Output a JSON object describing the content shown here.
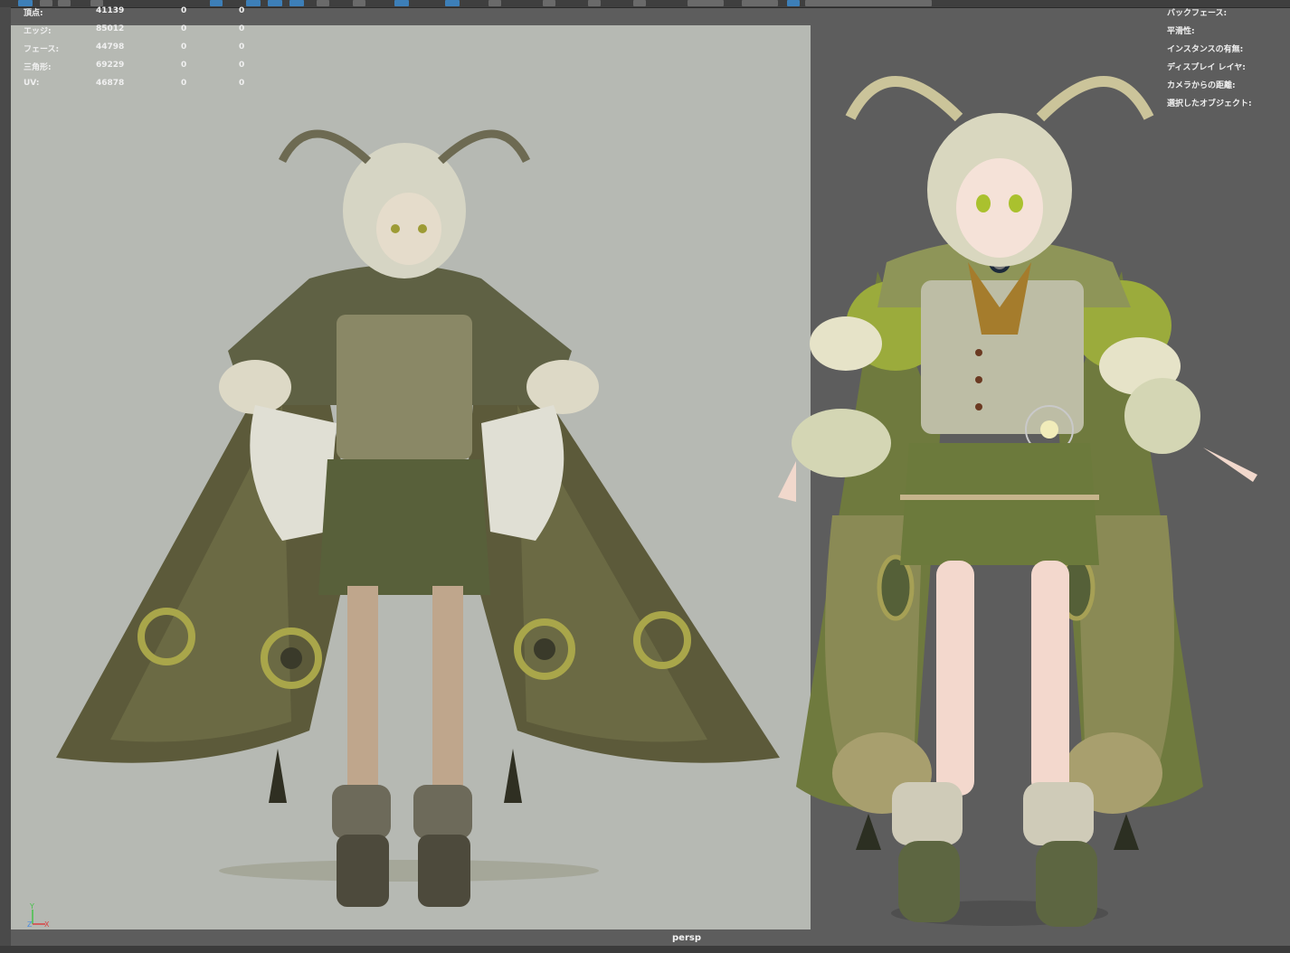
{
  "stats": {
    "rows": [
      {
        "label": "頂点:",
        "v1": "41139",
        "v2": "0",
        "v3": "0"
      },
      {
        "label": "エッジ:",
        "v1": "85012",
        "v2": "0",
        "v3": "0"
      },
      {
        "label": "フェース:",
        "v1": "44798",
        "v2": "0",
        "v3": "0"
      },
      {
        "label": "三角形:",
        "v1": "69229",
        "v2": "0",
        "v3": "0"
      },
      {
        "label": "UV:",
        "v1": "46878",
        "v2": "0",
        "v3": "0"
      }
    ]
  },
  "hud_right": {
    "items": [
      "バックフェース:",
      "平滑性:",
      "インスタンスの有無:",
      "ディスプレイ レイヤ:",
      "カメラからの距離:",
      "選択したオブジェクト:"
    ]
  },
  "camera": {
    "label": "persp"
  },
  "axis": {
    "y": "Y",
    "z": "Z",
    "x": "X"
  },
  "colors": {
    "viewport_bg": "#5d5d5d",
    "image_plane_bg": "#b6b9b3",
    "accent": "#3d7fb8"
  }
}
